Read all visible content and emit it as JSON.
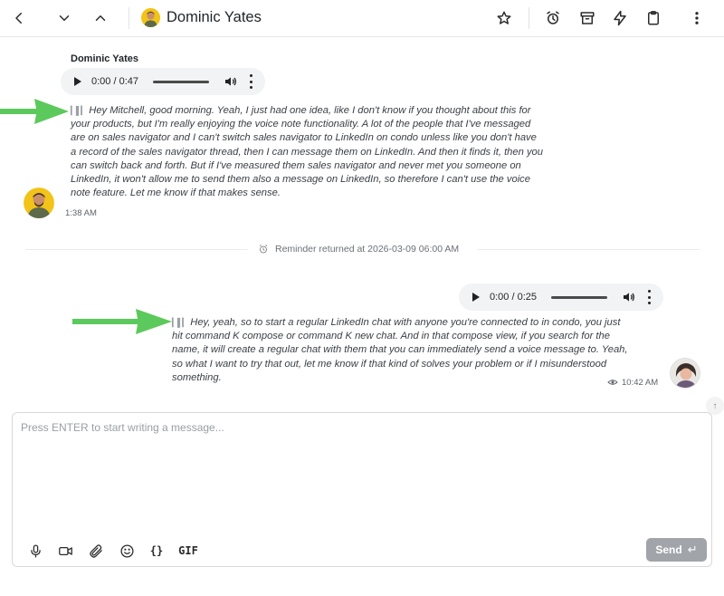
{
  "header": {
    "contact_name": "Dominic Yates",
    "icons": [
      "back-icon",
      "chevron-down-icon",
      "chevron-up-icon",
      "star-icon",
      "alarm-icon",
      "archive-icon",
      "lightning-icon",
      "clipboard-icon",
      "more-vertical-icon"
    ]
  },
  "messages": [
    {
      "sender": "Dominic Yates",
      "audio_time": "0:00 / 0:47",
      "transcript": "Hey Mitchell, good morning. Yeah, I just had one idea, like I don't know if you thought about this for your products, but I'm really enjoying the voice note functionality. A lot of the people that I've messaged are on sales navigator and I can't switch sales navigator to LinkedIn on condo unless like you don't have a record of the sales navigator thread, then I can message them on LinkedIn. And then it finds it, then you can switch back and forth. But if I've measured them sales navigator and never met you someone on LinkedIn, it won't allow me to send them also a message on LinkedIn, so therefore I can't use the voice note feature. Let me know if that makes sense.",
      "time": "1:38 AM"
    },
    {
      "audio_time": "0:00 / 0:25",
      "transcript": "Hey, yeah, so to start a regular LinkedIn chat with anyone you're connected to in condo, you just hit command K compose or command K new chat. And in that compose view, if you search for the name, it will create a regular chat with them that you can immediately send a voice message to. Yeah, so what I want to try that out, let me know if that kind of solves your problem or if I misunderstood something.",
      "time": "10:42 AM"
    }
  ],
  "reminder": {
    "text": "Reminder returned at 2026-03-09 06:00 AM"
  },
  "composer": {
    "placeholder": "Press ENTER to start writing a message...",
    "braces_label": "{}",
    "gif_label": "GIF",
    "send_label": "Send",
    "send_icon": "↵"
  },
  "colors": {
    "accent_arrow": "#5cc95c",
    "send_button": "#a1a4a8",
    "audio_bg": "#f1f3f4"
  }
}
